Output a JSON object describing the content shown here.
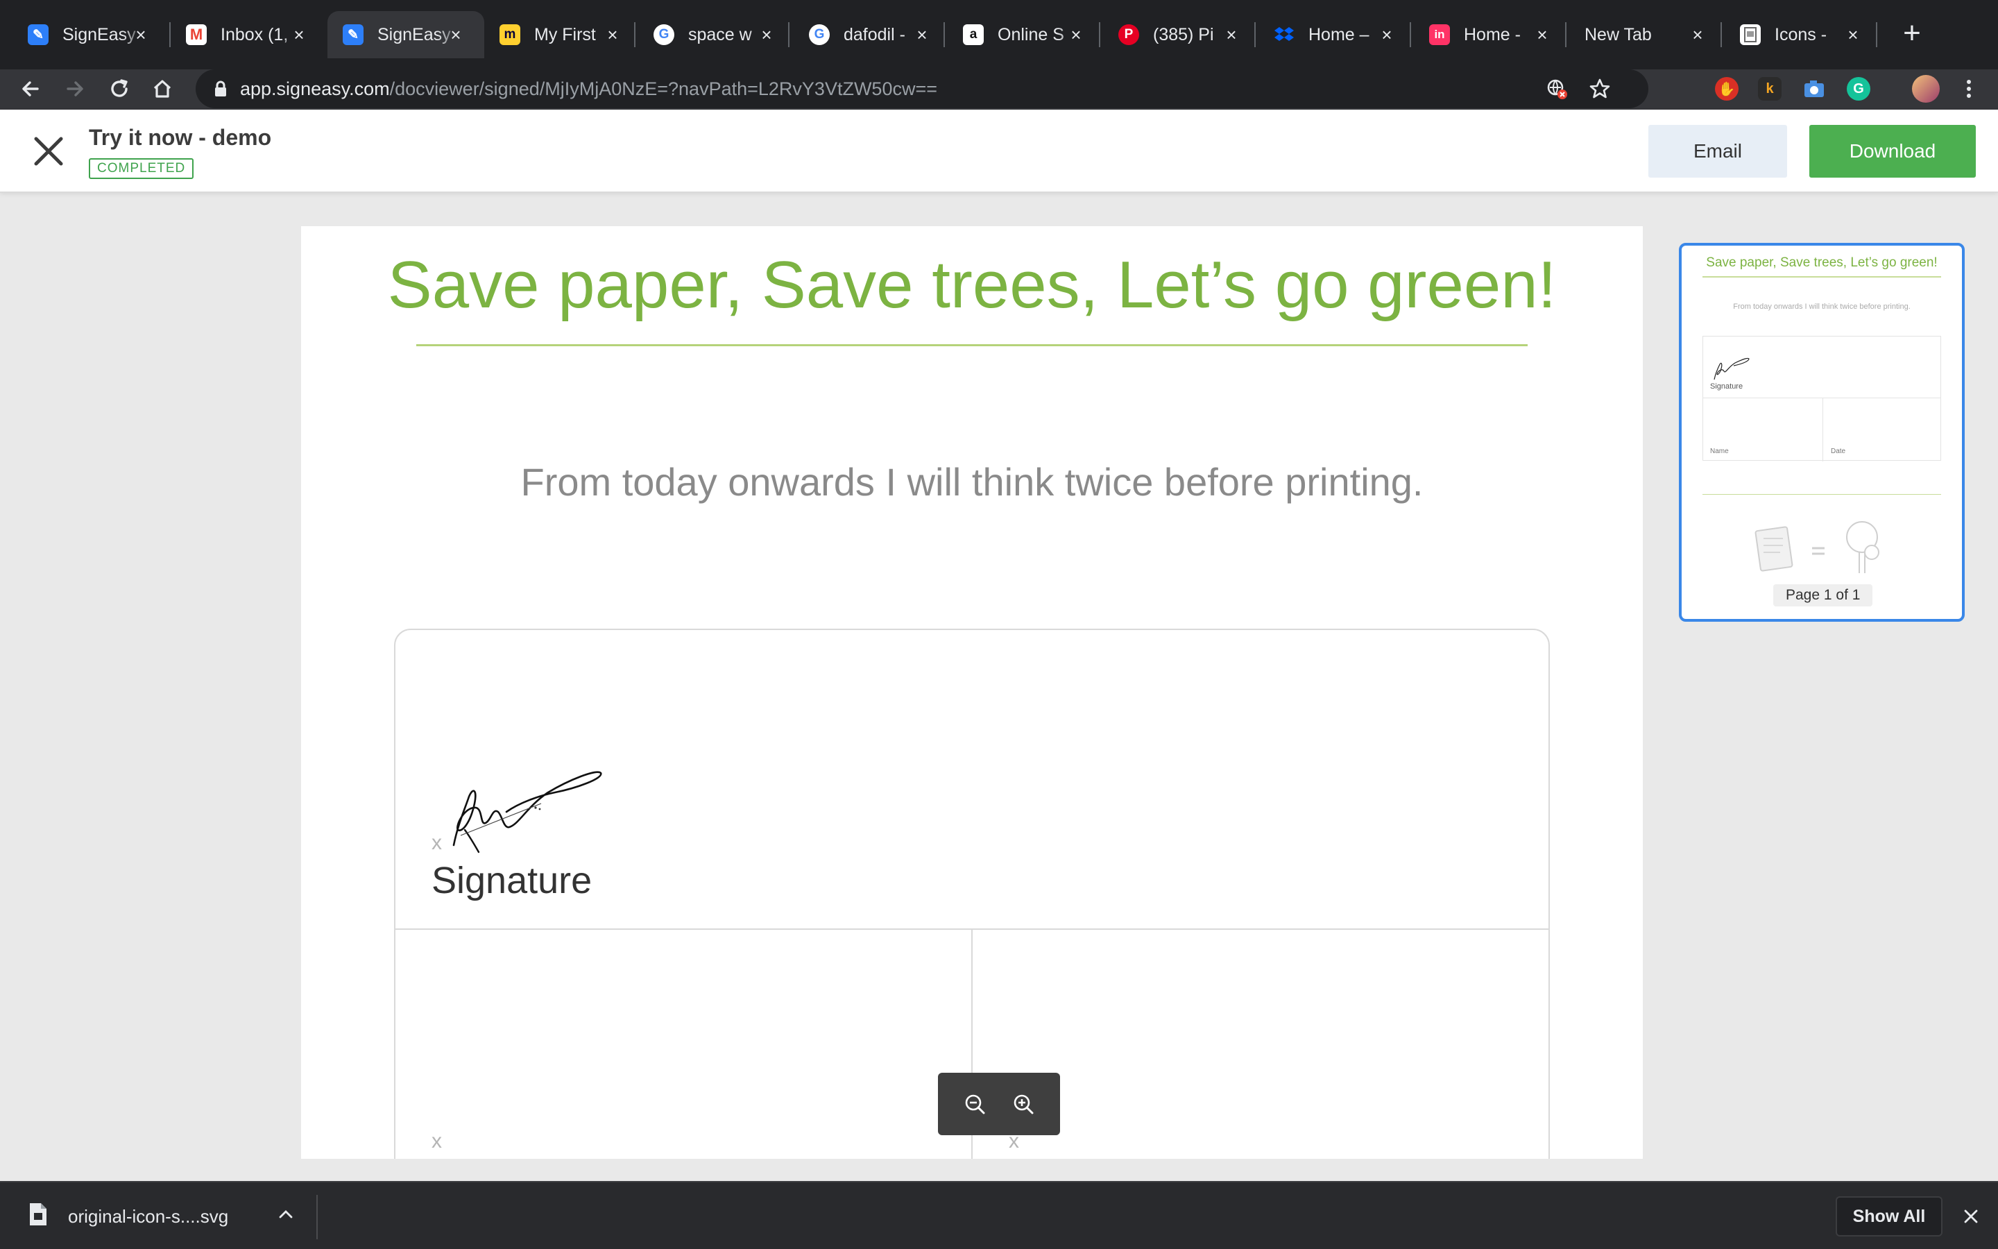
{
  "browser": {
    "tabs": [
      {
        "label": "SignEasy",
        "icon": "signeasy-icon",
        "color": "#2d7ff9",
        "active": false
      },
      {
        "label": "Inbox (1,",
        "icon": "gmail-icon",
        "color": "#ea4335",
        "active": false
      },
      {
        "label": "SignEasy",
        "icon": "signeasy-icon",
        "color": "#2d7ff9",
        "active": true
      },
      {
        "label": "My First",
        "icon": "miro-icon",
        "color": "#ffd02f",
        "active": false
      },
      {
        "label": "space w",
        "icon": "google-icon",
        "color": "#4285f4",
        "active": false
      },
      {
        "label": "dafodil -",
        "icon": "google-icon",
        "color": "#4285f4",
        "active": false
      },
      {
        "label": "Online S",
        "icon": "amazon-icon",
        "color": "#ffffff",
        "active": false
      },
      {
        "label": "(385) Pi",
        "icon": "pinterest-icon",
        "color": "#e60023",
        "active": false
      },
      {
        "label": "Home –",
        "icon": "dropbox-icon",
        "color": "#0061fe",
        "active": false
      },
      {
        "label": "Home -",
        "icon": "invision-icon",
        "color": "#ff3366",
        "active": false
      },
      {
        "label": "New Tab",
        "icon": "none",
        "color": "#202124",
        "active": false
      },
      {
        "label": "Icons -",
        "icon": "page-icon",
        "color": "#ffffff",
        "active": false
      }
    ],
    "url_host": "app.signeasy.com",
    "url_path": "/docviewer/signed/MjIyMjA0NzE=?navPath=L2RvY3VtZW50cw=="
  },
  "app": {
    "doc_title": "Try it now - demo",
    "status": "COMPLETED",
    "email_label": "Email",
    "download_label": "Download",
    "accent": "#4caf50"
  },
  "document": {
    "heading": "Save paper, Save trees, Let’s go green!",
    "subheading": "From today onwards I will think twice before printing.",
    "signature_marker": "x",
    "signature_label": "Signature",
    "name_marker": "x",
    "date_marker": "x",
    "heading_color": "#7cb342"
  },
  "thumbnail": {
    "heading": "Save paper, Save trees, Let’s go green!",
    "subheading": "From today onwards I will think twice before printing.",
    "signature_label": "Signature",
    "name_label": "Name",
    "date_label": "Date",
    "page_label": "Page 1 of 1"
  },
  "downloads": {
    "file_name": "original-icon-s....svg",
    "show_all_label": "Show All"
  }
}
